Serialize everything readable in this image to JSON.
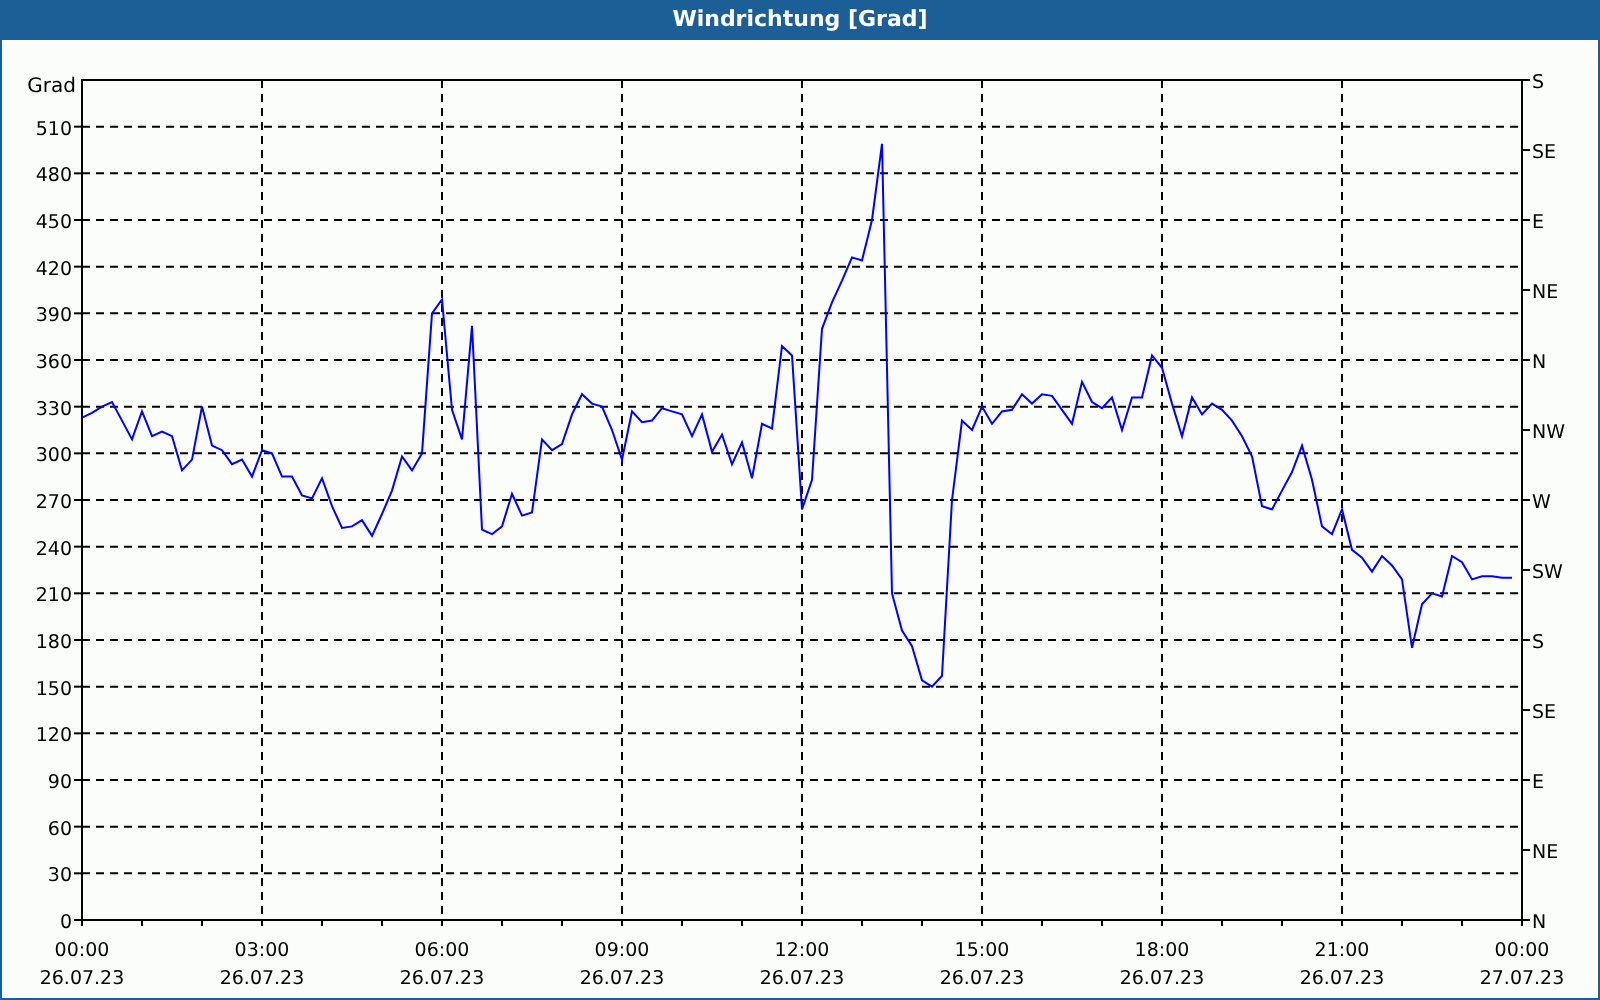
{
  "window": {
    "title": "Windrichtung [Grad]"
  },
  "chart": {
    "chart_data": {
      "type": "line",
      "grid": true,
      "ylabel": "Grad",
      "ylim": [
        0,
        540
      ],
      "yticks": [
        0,
        30,
        60,
        90,
        120,
        150,
        180,
        210,
        240,
        270,
        300,
        330,
        360,
        390,
        420,
        450,
        480,
        510
      ],
      "categories": [
        "00:00\n26.07.23",
        null,
        null,
        null,
        null,
        null,
        null,
        null,
        null,
        null,
        null,
        null,
        null,
        null,
        null,
        null,
        null,
        null,
        "03:00\n26.07.23",
        null,
        null,
        null,
        null,
        null,
        null,
        null,
        null,
        null,
        null,
        null,
        null,
        null,
        null,
        null,
        null,
        null,
        "06:00\n26.07.23",
        null,
        null,
        null,
        null,
        null,
        null,
        null,
        null,
        null,
        null,
        null,
        null,
        null,
        null,
        null,
        null,
        null,
        "09:00\n26.07.23",
        null,
        null,
        null,
        null,
        null,
        null,
        null,
        null,
        null,
        null,
        null,
        null,
        null,
        null,
        null,
        null,
        null,
        "12:00\n26.07.23",
        null,
        null,
        null,
        null,
        null,
        null,
        null,
        null,
        null,
        null,
        null,
        null,
        null,
        null,
        null,
        null,
        null,
        "15:00\n26.07.23",
        null,
        null,
        null,
        null,
        null,
        null,
        null,
        null,
        null,
        null,
        null,
        null,
        null,
        null,
        null,
        null,
        null,
        "18:00\n26.07.23",
        null,
        null,
        null,
        null,
        null,
        null,
        null,
        null,
        null,
        null,
        null,
        null,
        null,
        null,
        null,
        null,
        null,
        "21:00\n26.07.23",
        null,
        null,
        null,
        null,
        null,
        null,
        null,
        null,
        null,
        null,
        null,
        null,
        null,
        null,
        null,
        null,
        null,
        "00:00\n27.07.23"
      ],
      "series": [
        {
          "color": "#0000ff",
          "values": [
            323,
            326,
            330,
            333,
            321,
            309,
            327,
            311,
            314,
            311,
            289,
            296,
            330,
            305,
            302,
            293,
            296,
            285,
            302,
            300,
            285,
            285,
            273,
            271,
            284,
            266,
            252,
            253,
            257,
            247,
            261,
            276,
            298,
            289,
            300,
            390,
            399,
            328,
            309,
            382,
            251,
            248,
            253,
            274,
            260,
            262,
            309,
            302,
            306,
            325,
            338,
            332,
            330,
            315,
            296,
            327,
            320,
            321,
            329,
            327,
            325,
            311,
            325,
            301,
            312,
            293,
            307,
            284,
            319,
            316,
            369,
            363,
            264,
            283,
            380,
            397,
            411,
            426,
            424,
            450,
            499,
            210,
            186,
            176,
            154,
            150,
            157,
            270,
            321,
            315,
            330,
            319,
            327,
            328,
            338,
            332,
            338,
            337,
            328,
            319,
            346,
            333,
            329,
            336,
            315,
            336,
            336,
            363,
            355,
            332,
            311,
            336,
            325,
            332,
            328,
            321,
            311,
            298,
            266,
            264,
            276,
            288,
            305,
            283,
            253,
            248,
            264,
            238,
            233,
            224,
            234,
            228,
            219,
            175,
            203,
            210,
            208,
            234,
            230,
            219,
            221,
            221,
            220,
            220,
            null
          ]
        }
      ]
    },
    "right_axis_labels": [
      "S",
      "SE",
      "E",
      "NE",
      "N",
      "NW",
      "W",
      "SW",
      "S",
      "SE",
      "E",
      "NE",
      "N"
    ]
  }
}
